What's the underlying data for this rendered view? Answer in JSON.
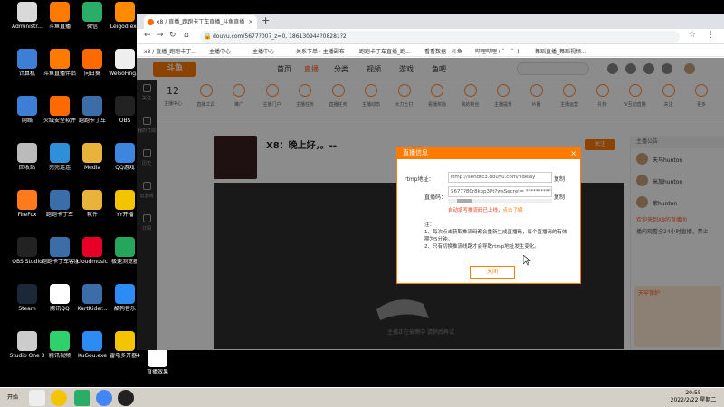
{
  "desktop": {
    "icons": [
      {
        "label": "Administr...",
        "color": "#d9d9d9"
      },
      {
        "label": "斗鱼直播",
        "color": "#ff7a00"
      },
      {
        "label": "微信",
        "color": "#2aae67"
      },
      {
        "label": "Leigod.exe",
        "color": "#ff8a00"
      },
      {
        "label": "计算机",
        "color": "#3d7fd6"
      },
      {
        "label": "斗鱼直播伴侣",
        "color": "#ff7a00"
      },
      {
        "label": "向日葵",
        "color": "#ff6a00"
      },
      {
        "label": "WeGoFing...",
        "color": "#eeeeee"
      },
      {
        "label": "网络",
        "color": "#3d7fd6"
      },
      {
        "label": "火绒安全软件",
        "color": "#ff6a00"
      },
      {
        "label": "跑跑卡丁车",
        "color": "#3b6ea8"
      },
      {
        "label": "OBS",
        "color": "#222222"
      },
      {
        "label": "回收站",
        "color": "#bbbbbb"
      },
      {
        "label": "亮亮连连",
        "color": "#2f8fd8"
      },
      {
        "label": "Media",
        "color": "#e8b33a"
      },
      {
        "label": "QQ游戏",
        "color": "#3c86e0"
      },
      {
        "label": "FireFox",
        "color": "#ff7a1a"
      },
      {
        "label": "跑跑卡丁车",
        "color": "#3b6ea8"
      },
      {
        "label": "软件",
        "color": "#e8b33a"
      },
      {
        "label": "YY开播",
        "color": "#f5c400"
      },
      {
        "label": "OBS Studio",
        "color": "#222222"
      },
      {
        "label": "跑跑卡丁车客服",
        "color": "#3b6ea8"
      },
      {
        "label": "cloudmusic",
        "color": "#e60026"
      },
      {
        "label": "极速浏览器",
        "color": "#26a65b"
      },
      {
        "label": "Steam",
        "color": "#1b2838"
      },
      {
        "label": "腾讯QQ",
        "color": "#ffffff"
      },
      {
        "label": "KartRider...",
        "color": "#3b6ea8"
      },
      {
        "label": "酷狗音乐",
        "color": "#2c8cf4"
      },
      {
        "label": "Studio One 3",
        "color": "#cccccc"
      },
      {
        "label": "腾讯视频",
        "color": "#2ed16c"
      },
      {
        "label": "KuGou.exe",
        "color": "#2c8cf4"
      },
      {
        "label": "雷电多开器4",
        "color": "#f5c400"
      },
      {
        "label": "直播效果",
        "color": "#ffffff"
      }
    ]
  },
  "browser": {
    "tab_title": "x8 / 直播_跑跑卡丁车直播_斗鱼直播",
    "new_tab": "+",
    "tab_close": "×",
    "back": "←",
    "forward": "→",
    "reload": "↻",
    "home": "⌂",
    "url": "douyu.com/5677?007_z=0, 186130944?08281?2",
    "bookmarks": [
      "x8 / 直播_跑跑卡丁...",
      "主播中心",
      "主播中心",
      "关系下单 · 主播副布",
      "跑跑卡丁车直播_跑...",
      "看看数据 - 斗鱼",
      "哔哩哔哩 ( ゜- ゜)",
      "舞蹈直播_舞蹈视频..."
    ]
  },
  "site": {
    "logo": "斗鱼",
    "nav": [
      "首页",
      "直播",
      "分类",
      "视频",
      "游戏",
      "鱼吧"
    ],
    "sidebar": [
      "关注",
      "我的订阅",
      "历史",
      "云游戏",
      "订阅"
    ],
    "level": "12",
    "tools": [
      "主播中心",
      "直播工具",
      "推广",
      "主播门户",
      "主播任务",
      "直播任务",
      "主播动态",
      "大力士打",
      "看播奖励",
      "我的粉丝",
      "主播提升",
      "片播",
      "主播运营",
      "礼物",
      "V互动直播",
      "关注",
      "更多"
    ],
    "room_title": "X8：晚上好，。--",
    "follow": "关注",
    "player_msg": "主播正在偷懒中    请稍后再试",
    "rp_head": "主播公告",
    "fans": [
      "天马hunton",
      "米加hunton",
      "紫hunton"
    ],
    "chat": [
      "欢迎来到X8的直播间",
      "播内观看全24小时直播，禁止"
    ],
    "promo": "天罕保护"
  },
  "dialog": {
    "title": "直播信息",
    "close": "×",
    "rtmp_label": "rtmp地址：",
    "rtmp_value": "rtmp://sendtc3.douyu.com/hdelay",
    "key_label": "直播码：",
    "key_value": "5677?80r8kop3Pt?wsSecret= ***********",
    "copy": "复制",
    "copy2": "复制",
    "auto_msg": "自动填写推流码已上线，",
    "learn_more": "点击了解",
    "note_head": "注：",
    "note1": "1、每次点击获取推流码都会重新生成直播码，每个直播码的有效期为5分钟。",
    "note2": "2、只有切换推流线路才会导致rtmp地址发生变化。",
    "ok": "关闭"
  },
  "taskbar": {
    "start": "开始",
    "time": "20:55",
    "date": "2022/2/22 星期二"
  }
}
